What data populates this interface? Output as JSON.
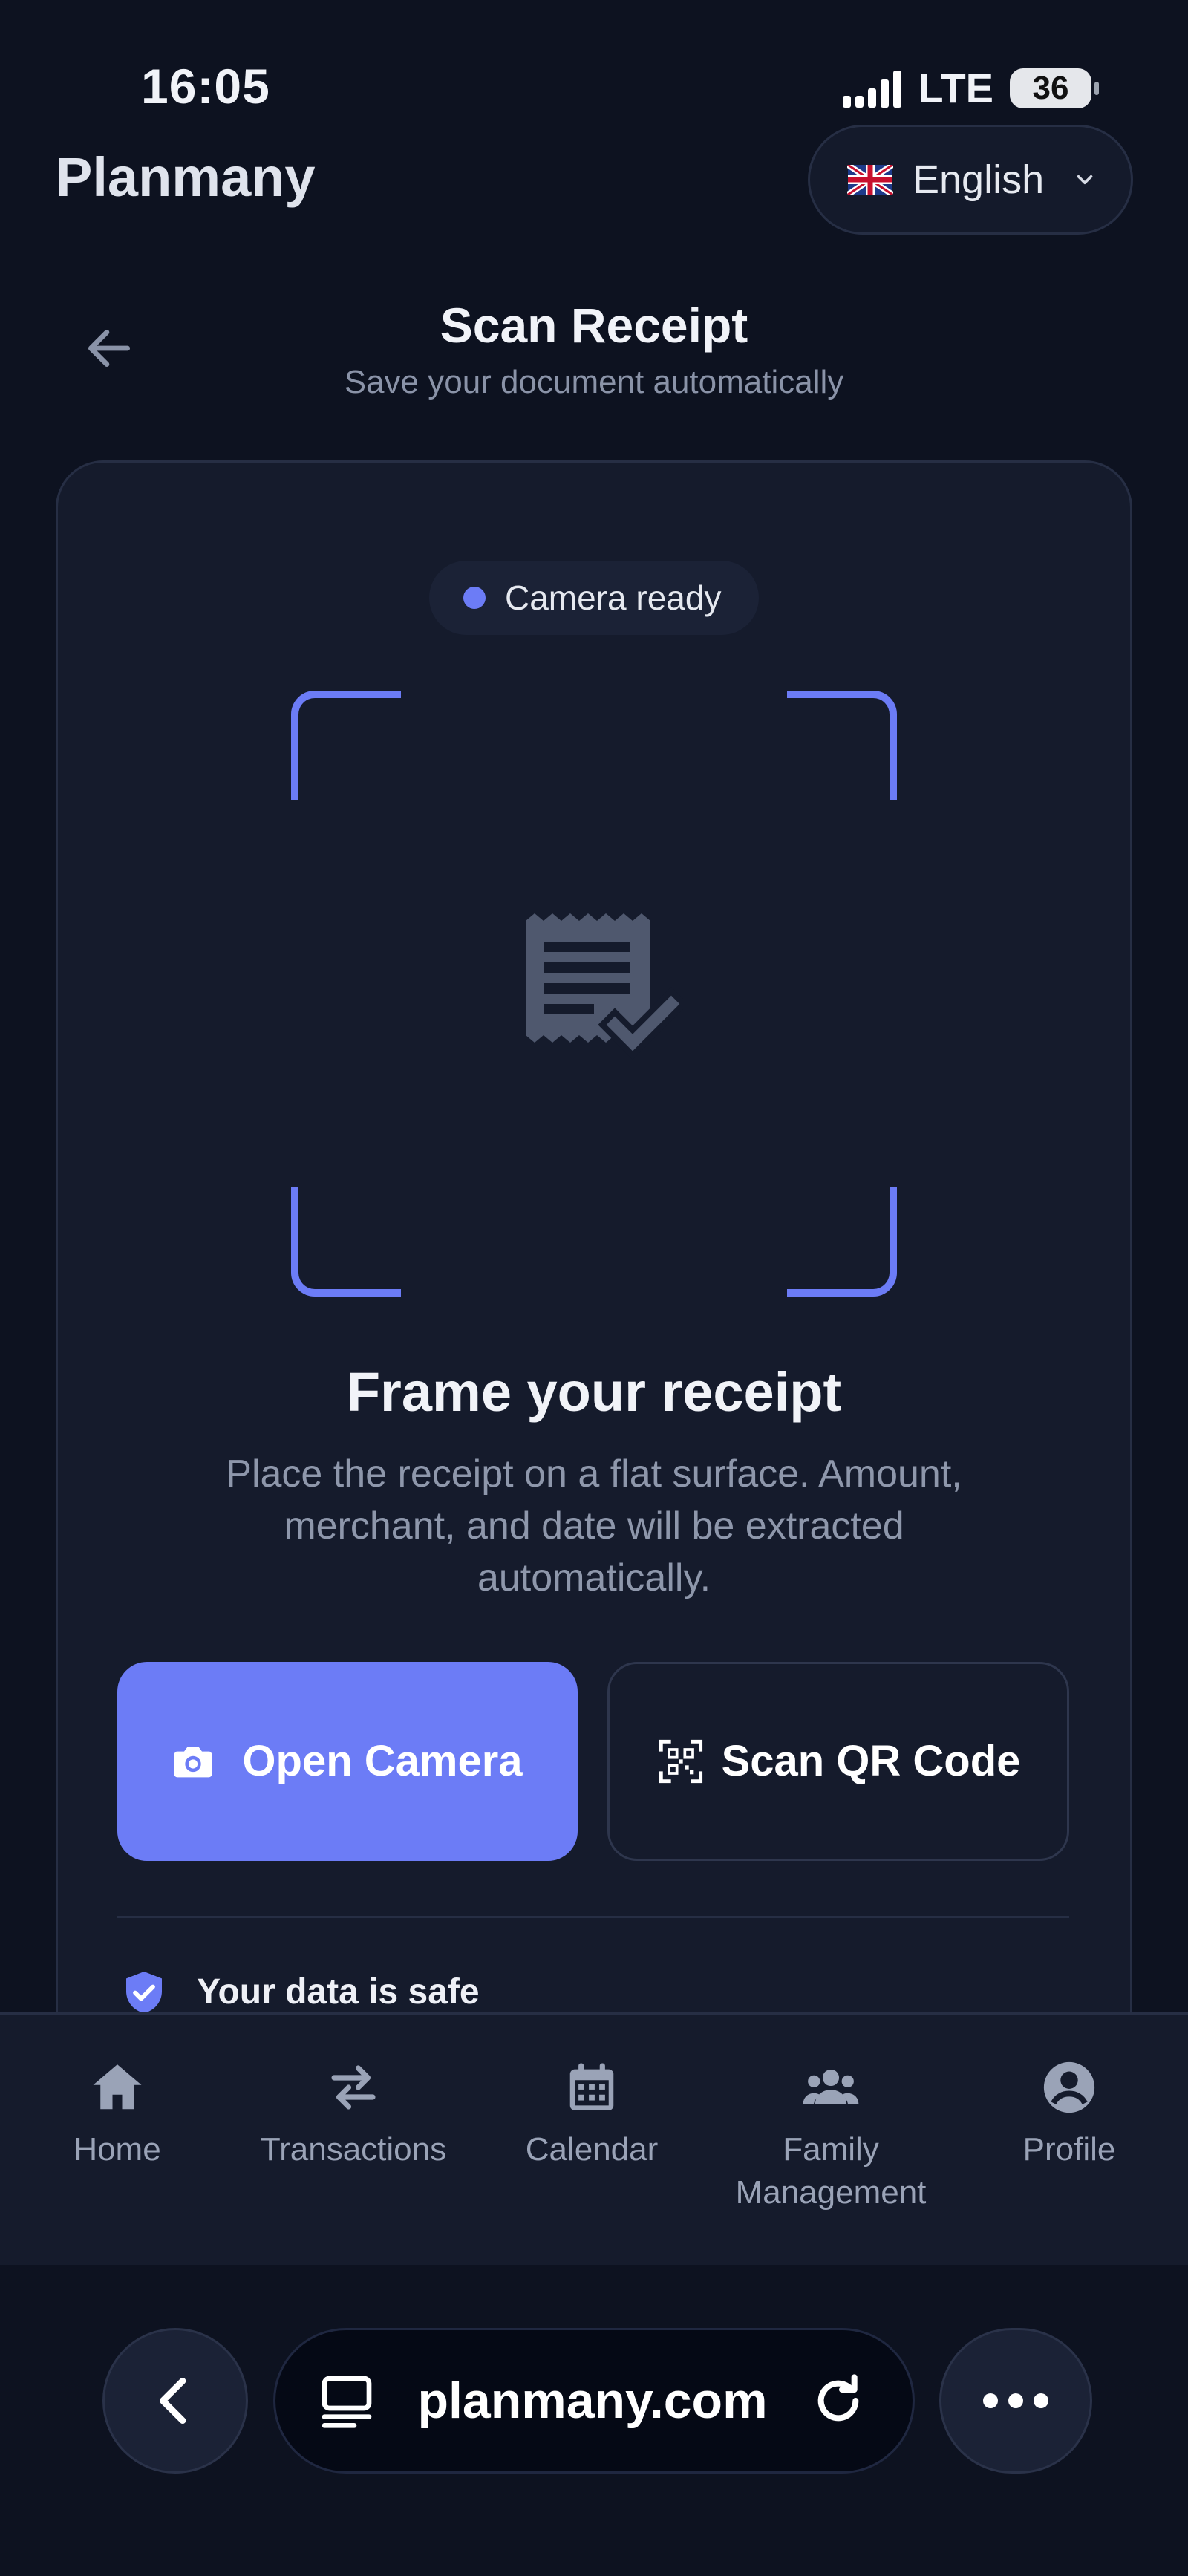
{
  "status_bar": {
    "time": "16:05",
    "network": "LTE",
    "battery": "36"
  },
  "header": {
    "brand": "Planmany",
    "language": "English"
  },
  "page": {
    "title": "Scan Receipt",
    "subtitle": "Save your document automatically"
  },
  "scanner": {
    "status": "Camera ready",
    "frame_title": "Frame your receipt",
    "frame_description": "Place the receipt on a flat surface. Amount, merchant, and date will be extracted automatically.",
    "open_camera_label": "Open Camera",
    "scan_qr_label": "Scan QR Code",
    "safety_note": "Your data is safe"
  },
  "nav": {
    "items": [
      {
        "label": "Home",
        "icon": "home-icon"
      },
      {
        "label": "Transactions",
        "icon": "swap-arrows-icon"
      },
      {
        "label": "Calendar",
        "icon": "calendar-icon"
      },
      {
        "label": "Family Management",
        "icon": "group-icon"
      },
      {
        "label": "Profile",
        "icon": "user-circle-icon"
      }
    ]
  },
  "browser": {
    "url": "planmany.com"
  },
  "colors": {
    "accent": "#6c7cf6",
    "background": "#0d1220",
    "card": "#151b2c"
  }
}
